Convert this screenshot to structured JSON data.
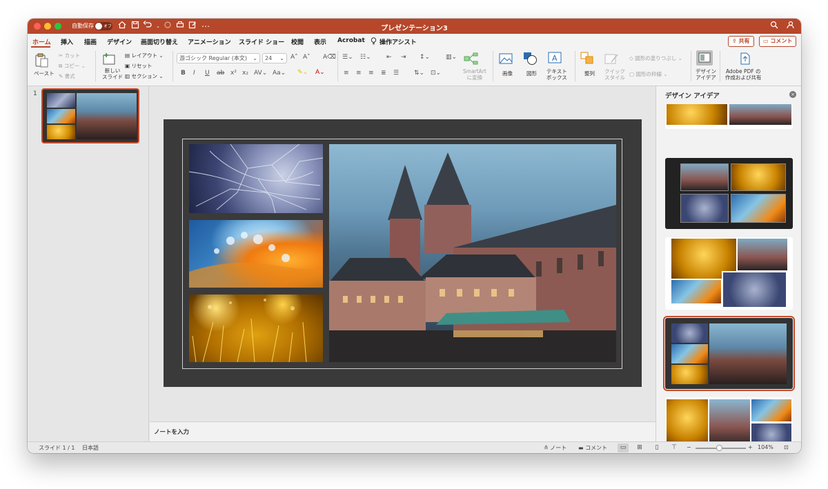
{
  "window": {
    "title": "プレゼンテーション3",
    "autosave_label": "自動保存",
    "autosave_state": "オフ"
  },
  "tabs": [
    "ホーム",
    "挿入",
    "描画",
    "デザイン",
    "画面切り替え",
    "アニメーション",
    "スライド ショー",
    "校閲",
    "表示",
    "Acrobat"
  ],
  "assist_label": "操作アシスト",
  "share_label": "共有",
  "comment_label": "コメント",
  "ribbon": {
    "paste": "ペースト",
    "cut": "カット",
    "copy": "コピー",
    "format": "書式",
    "new_slide": [
      "新しい",
      "スライド"
    ],
    "layout": "レイアウト",
    "reset": "リセット",
    "section": "セクション",
    "font_name": "游ゴシック Regular (本文)",
    "font_size": "24",
    "smartart": [
      "SmartArt",
      "に変換"
    ],
    "picture": "画像",
    "shapes": "図形",
    "textbox": [
      "テキスト",
      "ボックス"
    ],
    "arrange": "整列",
    "quick_style": [
      "クイック",
      "スタイル"
    ],
    "shape_fill": "図形の塗りつぶし",
    "shape_outline": "図形の枠線",
    "design_ideas": [
      "デザイン",
      "アイデア"
    ],
    "adobe_pdf": [
      "Adobe PDF の",
      "作成および共有"
    ]
  },
  "slides_pane": {
    "slide_number": "1"
  },
  "notes_placeholder": "ノートを入力",
  "designer": {
    "title": "デザイン アイデア"
  },
  "status": {
    "slide_indicator": "スライド 1 / 1",
    "language": "日本語",
    "notes": "ノート",
    "comments": "コメント",
    "zoom": "104%"
  },
  "colors": {
    "accent": "#b7472a",
    "selection": "#c74b2a",
    "slide_bg": "#3a3a3a"
  }
}
